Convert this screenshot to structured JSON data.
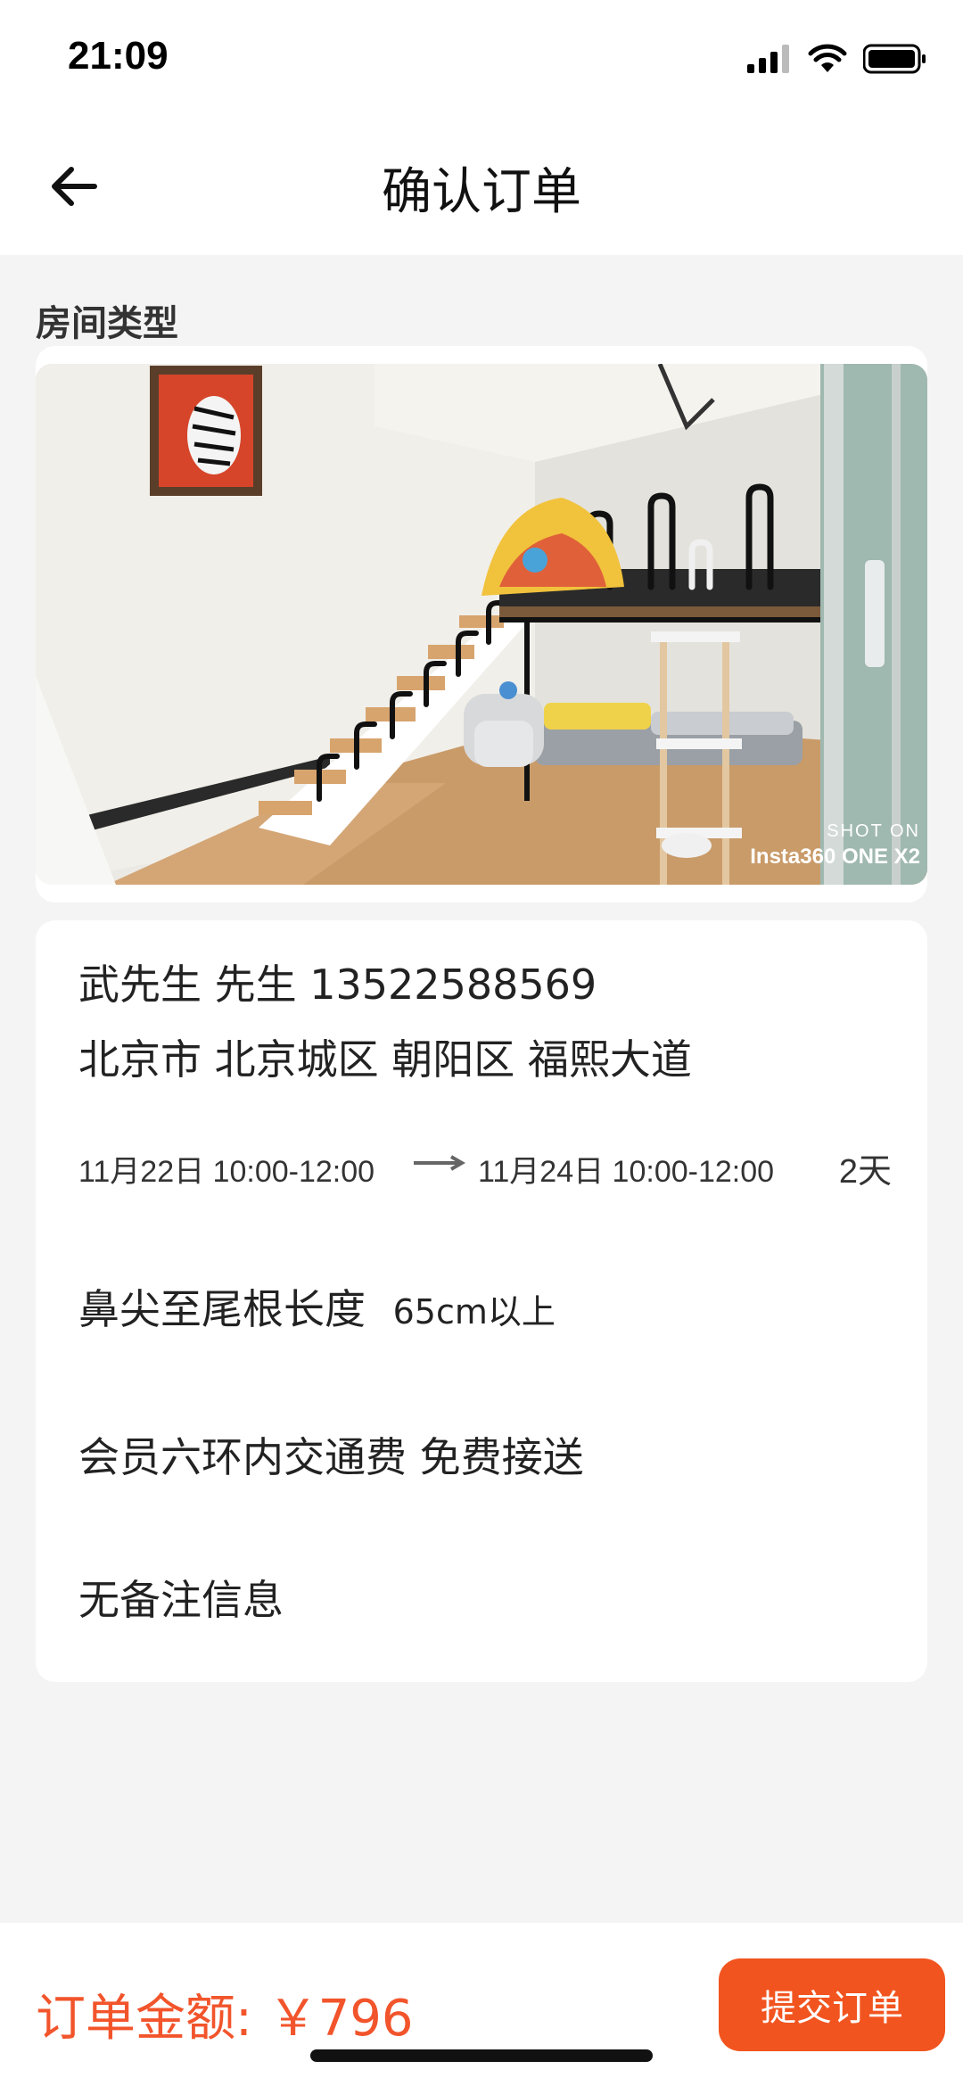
{
  "status_bar": {
    "time": "21:09"
  },
  "nav": {
    "title": "确认订单"
  },
  "room": {
    "section_label": "房间类型",
    "photo_caption_1": "SHOT ON",
    "photo_caption_2": "Insta360 ONE X2"
  },
  "order": {
    "contact": "武先生 先生 13522588569",
    "address": "北京市 北京城区 朝阳区 福熙大道",
    "start": "11月22日 10:00-12:00",
    "end": "11月24日 10:00-12:00",
    "duration": "2天",
    "size_label": "鼻尖至尾根长度",
    "size_value": "65cm以上",
    "transport": "会员六环内交通费 免费接送",
    "note": "无备注信息"
  },
  "footer": {
    "price": "订单金额: ￥796",
    "submit_label": "提交订单"
  },
  "colors": {
    "accent": "#f2541f",
    "price": "#f2542b",
    "background": "#f4f4f4"
  }
}
